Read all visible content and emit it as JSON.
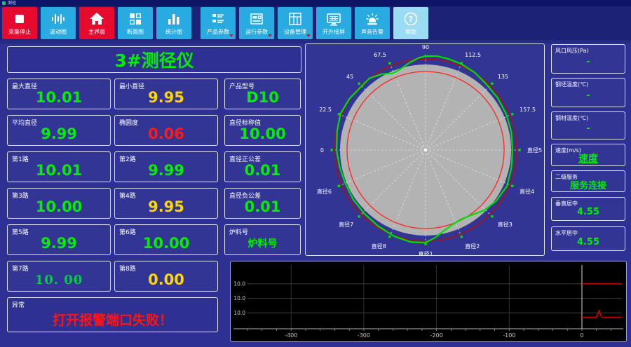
{
  "window": {
    "title": "测径"
  },
  "toolbar": {
    "buttons": [
      {
        "label": "采集停止",
        "icon": "stop-icon",
        "style": "red",
        "dropdown": false
      },
      {
        "label": "波动图",
        "icon": "waveform-icon",
        "style": "blue",
        "dropdown": false
      },
      {
        "label": "主界面",
        "icon": "home-icon",
        "style": "red",
        "dropdown": false
      },
      {
        "label": "断面图",
        "icon": "section-view-icon",
        "style": "blue",
        "dropdown": false
      },
      {
        "label": "统计图",
        "icon": "bar-chart-icon",
        "style": "blue",
        "dropdown": false
      },
      {
        "label": "产品参数",
        "icon": "product-params-icon",
        "style": "blue",
        "dropdown": true
      },
      {
        "label": "运行参数",
        "icon": "run-params-icon",
        "style": "blue",
        "dropdown": true
      },
      {
        "label": "设备管理",
        "icon": "device-manage-icon",
        "style": "blue",
        "dropdown": true
      },
      {
        "label": "开外接屏",
        "icon": "external-screen-icon",
        "style": "blue",
        "dropdown": false
      },
      {
        "label": "声音告警",
        "icon": "siren-icon",
        "style": "blue",
        "dropdown": false
      },
      {
        "label": "帮助",
        "icon": "help-icon",
        "style": "lighter",
        "dropdown": false
      }
    ]
  },
  "main_title": "3#测径仪",
  "measurements": [
    {
      "label": "最大直径",
      "value": "10.01",
      "color": "#00ee00"
    },
    {
      "label": "最小直径",
      "value": "9.95",
      "color": "#ffd700"
    },
    {
      "label": "产品型号",
      "value": "D10",
      "color": "#00ee00"
    },
    {
      "label": "平均直径",
      "value": "9.99",
      "color": "#00ee00"
    },
    {
      "label": "椭圆度",
      "value": "0.06",
      "color": "#ff1a1a"
    },
    {
      "label": "直径标称值",
      "value": "10.00",
      "color": "#00ee00"
    },
    {
      "label": "第1路",
      "value": "10.01",
      "color": "#00ee00"
    },
    {
      "label": "第2路",
      "value": "9.99",
      "color": "#00ee00"
    },
    {
      "label": "直径正公差",
      "value": "0.01",
      "color": "#00ee00"
    },
    {
      "label": "第3路",
      "value": "10.00",
      "color": "#00ee00"
    },
    {
      "label": "第4路",
      "value": "9.95",
      "color": "#ffd700"
    },
    {
      "label": "直径负公差",
      "value": "0.01",
      "color": "#00ee00"
    },
    {
      "label": "第5路",
      "value": "9.99",
      "color": "#00ee00"
    },
    {
      "label": "第6路",
      "value": "10.00",
      "color": "#00ee00"
    },
    {
      "label": "炉料号",
      "value": "炉料号",
      "color": "#00ee00",
      "small": true
    },
    {
      "label": "第7路",
      "value": "10. 00",
      "color": "#00cc44",
      "serif": true
    },
    {
      "label": "第8路",
      "value": "0.00",
      "color": "#ffd700"
    },
    null
  ],
  "exception": {
    "label": "异常",
    "value": "打开报警端口失败！"
  },
  "side_panel": [
    {
      "label": "风口风压(Pa)",
      "value": "-"
    },
    {
      "label": "钢坯温度(℃)",
      "value": "-"
    },
    {
      "label": "钢材温度(℃)",
      "value": "-"
    },
    {
      "label": "速度(m/s)",
      "value": "速度",
      "link": true
    },
    {
      "label": "二级服务",
      "value": "服务连接"
    },
    {
      "label": "垂直居中",
      "value": "4.55"
    },
    {
      "label": "水平居中",
      "value": "4.55"
    }
  ],
  "chart_data": {
    "polar": {
      "type": "polar-profile",
      "grid_spoke_step_deg": 22.5,
      "angle_tick_labels": [
        "0",
        "22.5",
        "45",
        "67.5",
        "90",
        "112.5",
        "135",
        "157.5"
      ],
      "diameter_spoke_labels": [
        "直径5",
        "直径4",
        "直径3",
        "直径2",
        "直径1",
        "直径8",
        "直径7",
        "直径6"
      ],
      "diameter_spoke_angles_deg": [
        0,
        -22.5,
        -45,
        -67.5,
        -90,
        -112.5,
        -135,
        -157.5
      ],
      "disk_radius": 122,
      "nominal_circle_radius": 112,
      "tolerance_circle_radius": 130,
      "colors": {
        "disk": "#b3b3b3",
        "nominal": "#ff2222",
        "tolerance": "#a81212",
        "profile": "#00dd00",
        "grid": "#f0f0f0"
      },
      "profile_points_deg_r": [
        [
          180,
          127
        ],
        [
          168,
          129
        ],
        [
          157,
          132
        ],
        [
          146,
          131
        ],
        [
          138,
          129
        ],
        [
          128,
          130
        ],
        [
          120,
          125
        ],
        [
          113,
          119
        ],
        [
          107,
          121
        ],
        [
          100,
          127
        ],
        [
          94,
          132
        ],
        [
          90,
          134
        ],
        [
          83,
          135
        ],
        [
          76,
          134
        ],
        [
          68,
          133
        ],
        [
          58,
          131
        ],
        [
          48,
          128
        ],
        [
          36,
          127
        ],
        [
          24,
          126
        ],
        [
          12,
          125
        ],
        [
          0,
          124
        ],
        [
          -12,
          125
        ],
        [
          -24,
          127
        ],
        [
          -36,
          124
        ],
        [
          -46,
          120
        ],
        [
          -56,
          113
        ],
        [
          -63,
          111
        ],
        [
          -70,
          113
        ],
        [
          -78,
          119
        ],
        [
          -84,
          126
        ],
        [
          -90,
          132
        ],
        [
          -99,
          133
        ],
        [
          -110,
          131
        ],
        [
          -122,
          128
        ],
        [
          -134,
          126
        ],
        [
          -146,
          125
        ],
        [
          -158,
          124
        ],
        [
          -169,
          125
        ]
      ]
    },
    "trend": {
      "type": "line",
      "background": "#000000",
      "x_range": [
        -460,
        55
      ],
      "x_tick_labels": [
        -400,
        -300,
        -200,
        -100,
        0
      ],
      "x_minor_tick_step": 20,
      "y_range": [
        9.895,
        10.115
      ],
      "y_gridline_values": [
        10.05,
        10.0,
        9.95
      ],
      "y_gridline_labels": [
        "10.0",
        "10.0",
        "10.0"
      ],
      "series": [
        {
          "name": "upper-trace",
          "color": "#cc0000",
          "points": [
            [
              0,
              10.05
            ],
            [
              55,
              10.05
            ]
          ]
        },
        {
          "name": "lower-trace",
          "color": "#cc0000",
          "points": [
            [
              0,
              9.935
            ],
            [
              20,
              9.935
            ],
            [
              23.5,
              9.957
            ],
            [
              27,
              9.935
            ],
            [
              55,
              9.935
            ]
          ]
        }
      ]
    }
  }
}
